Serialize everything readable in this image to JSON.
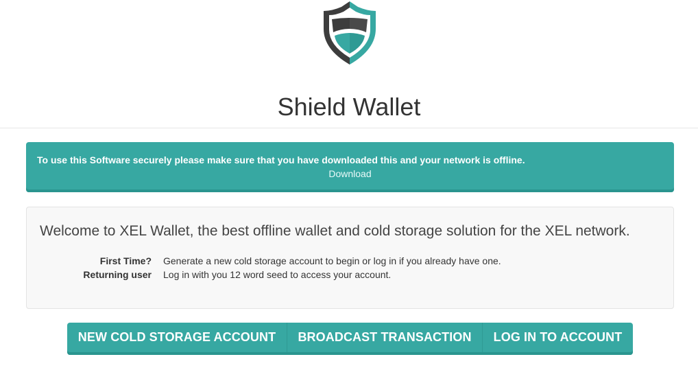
{
  "app": {
    "title": "Shield Wallet",
    "logo_icon": "shield-icon"
  },
  "alert": {
    "message": "To use this Software securely please make sure that you have downloaded this and your network is offline.",
    "link_label": "Download"
  },
  "welcome": {
    "heading": "Welcome to XEL Wallet, the best offline wallet and cold storage solution for the XEL network.",
    "rows": [
      {
        "label": "First Time?",
        "value": "Generate a new cold storage account to begin or log in if you already have one."
      },
      {
        "label": "Returning user",
        "value": "Log in with you 12 word seed to access your account."
      }
    ]
  },
  "actions": {
    "new_account": "NEW COLD STORAGE ACCOUNT",
    "broadcast": "BROADCAST TRANSACTION",
    "login": "LOG IN TO ACCOUNT"
  },
  "colors": {
    "accent": "#37a8a2",
    "accent_dark": "#2a958f",
    "shield_dark": "#3d3d3d",
    "panel_bg": "#f8f8f8"
  }
}
